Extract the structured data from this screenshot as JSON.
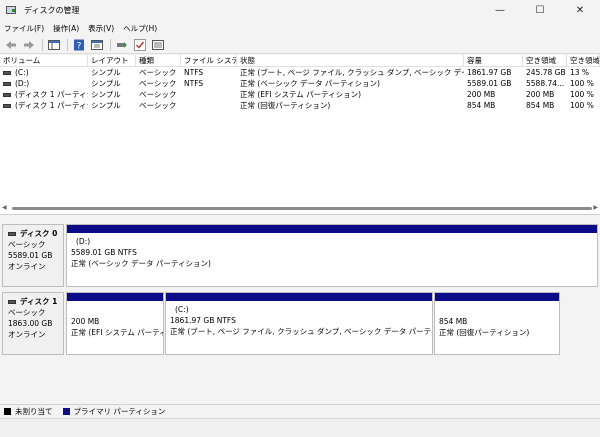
{
  "window": {
    "title": "ディスクの管理",
    "minimize": "—",
    "maximize": "☐",
    "close": "✕"
  },
  "menu": [
    "ファイル(F)",
    "操作(A)",
    "表示(V)",
    "ヘルプ(H)"
  ],
  "toolbar_icons": [
    "back-arrow-icon",
    "forward-arrow-icon",
    "console-tree-icon",
    "help-icon",
    "properties-icon",
    "connect-icon",
    "check-icon",
    "view-icon"
  ],
  "volumes": {
    "columns": [
      "ボリューム",
      "レイアウト",
      "種類",
      "ファイル システム",
      "状態",
      "容量",
      "空き領域",
      "空き領域"
    ],
    "rows": [
      {
        "name": "(C:)",
        "layout": "シンプル",
        "type": "ベーシック",
        "fs": "NTFS",
        "status": "正常 (ブート, ページ ファイル, クラッシュ ダンプ, ベーシック データ パーティション)",
        "capacity": "1861.97 GB",
        "free": "245.78 GB",
        "free_pct": "13 %"
      },
      {
        "name": "(D:)",
        "layout": "シンプル",
        "type": "ベーシック",
        "fs": "NTFS",
        "status": "正常 (ベーシック データ パーティション)",
        "capacity": "5589.01 GB",
        "free": "5588.74...",
        "free_pct": "100 %"
      },
      {
        "name": "(ディスク 1 パーティション...",
        "layout": "シンプル",
        "type": "ベーシック",
        "fs": "",
        "status": "正常 (EFI システム パーティション)",
        "capacity": "200 MB",
        "free": "200 MB",
        "free_pct": "100 %"
      },
      {
        "name": "(ディスク 1 パーティショ...",
        "layout": "シンプル",
        "type": "ベーシック",
        "fs": "",
        "status": "正常 (回復パーティション)",
        "capacity": "854 MB",
        "free": "854 MB",
        "free_pct": "100 %"
      }
    ]
  },
  "disks": [
    {
      "title": "ディスク 0",
      "type": "ベーシック",
      "size": "5589.01 GB",
      "state": "オンライン",
      "partitions": [
        {
          "name": "(D:)",
          "size_fs": "5589.01 GB NTFS",
          "status": "正常 (ベーシック データ パーティション)"
        }
      ]
    },
    {
      "title": "ディスク 1",
      "type": "ベーシック",
      "size": "1863.00 GB",
      "state": "オンライン",
      "partitions": [
        {
          "name": "",
          "size_fs": "200 MB",
          "status": "正常 (EFI システム パーティショ"
        },
        {
          "name": "(C:)",
          "size_fs": "1861.97 GB NTFS",
          "status": "正常 (ブート, ページ ファイル, クラッシュ ダンプ, ベーシック データ パーティション)"
        },
        {
          "name": "",
          "size_fs": "854 MB",
          "status": "正常 (回復パーティション)"
        }
      ]
    }
  ],
  "legend": [
    {
      "label": "未割り当て",
      "color": "#000000"
    },
    {
      "label": "プライマリ パーティション",
      "color": "#0c0c8a"
    }
  ]
}
